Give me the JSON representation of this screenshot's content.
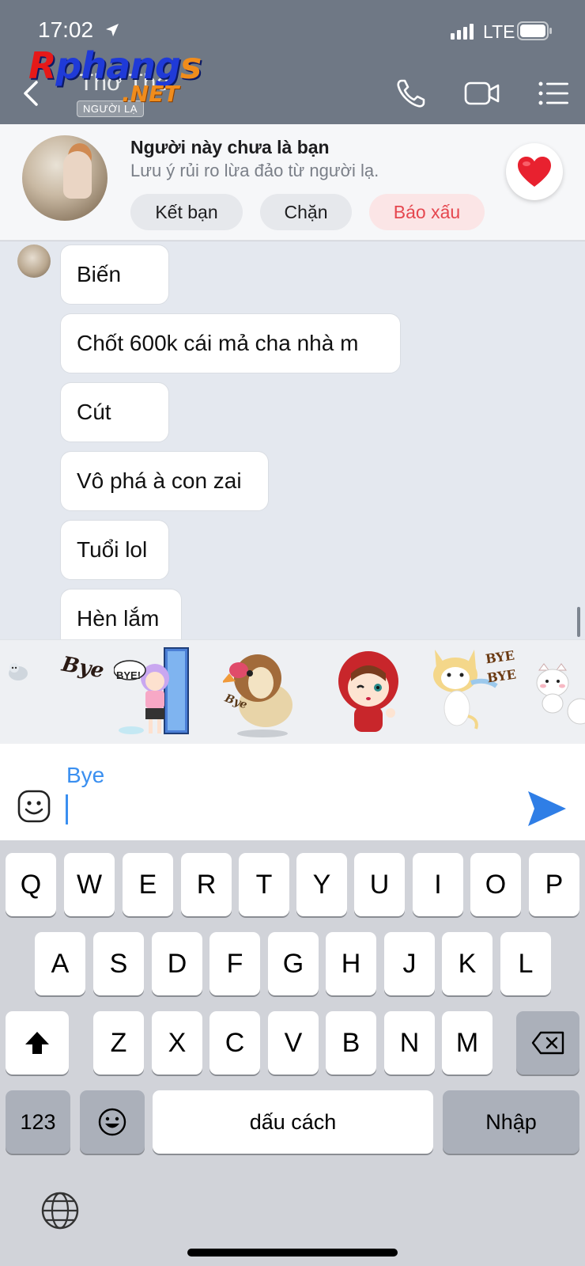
{
  "status_bar": {
    "time": "17:02",
    "network": "LTE"
  },
  "header": {
    "watermark": {
      "main_r": "R",
      "main_mid": "phang",
      "main_s": "s",
      "net": ".NET"
    },
    "contact_name": "Thơ Thơ",
    "badge": "NGƯỜI LẠ",
    "icons": [
      "back-icon",
      "phone-icon",
      "video-icon",
      "menu-icon"
    ]
  },
  "banner": {
    "title": "Người này chưa là bạn",
    "subtitle": "Lưu ý rủi ro lừa đảo từ người lạ.",
    "add_friend": "Kết bạn",
    "block": "Chặn",
    "report": "Báo xấu"
  },
  "messages": [
    "Biến",
    "Chốt 600k cái mả cha nhà m",
    "Cút",
    "Vô phá à con zai",
    "Tuổi lol",
    "Hèn lắm"
  ],
  "stickers": {
    "bye_text": "Bye",
    "bye_bubble": "BYE!",
    "bye_bye_1": "BYE",
    "bye_bye_2": "BYE",
    "bird_text": "Bye",
    "items": [
      "cat-sticker",
      "bye-text-sticker",
      "girl-door-sticker",
      "bird-sticker",
      "red-hood-sticker",
      "yellow-cat-sticker",
      "white-cat-sticker"
    ]
  },
  "input": {
    "suggestion": "Bye",
    "value": ""
  },
  "keyboard": {
    "row1": [
      "Q",
      "W",
      "E",
      "R",
      "T",
      "Y",
      "U",
      "I",
      "O",
      "P"
    ],
    "row2": [
      "A",
      "S",
      "D",
      "F",
      "G",
      "H",
      "J",
      "K",
      "L"
    ],
    "row3": [
      "Z",
      "X",
      "C",
      "V",
      "B",
      "N",
      "M"
    ],
    "numbers": "123",
    "space": "dấu cách",
    "enter": "Nhập"
  },
  "colors": {
    "header": "#6f7885",
    "accent": "#3a8ff0",
    "report": "#e5474f"
  }
}
